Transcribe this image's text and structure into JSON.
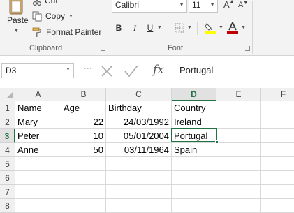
{
  "clipboard": {
    "paste_label": "Paste",
    "cut_label": "Cut",
    "copy_label": "Copy",
    "format_painter_label": "Format Painter",
    "group_label": "Clipboard"
  },
  "font": {
    "name": "Calibri",
    "size": "11",
    "group_label": "Font",
    "grow_label": "A",
    "shrink_label": "A",
    "bold_label": "B",
    "italic_label": "I",
    "underline_label": "U",
    "highlight_color": "#ffff00",
    "font_color": "#c00000"
  },
  "formula_bar": {
    "name_box": "D3",
    "fx_label": "fx",
    "formula": "Portugal"
  },
  "sheet": {
    "columns": [
      "A",
      "B",
      "C",
      "D",
      "E",
      "F"
    ],
    "rows": [
      "1",
      "2",
      "3",
      "4",
      "5",
      "6",
      "7",
      "8"
    ],
    "active_cell": "D3",
    "accent_color": "#217346",
    "data": {
      "header": {
        "a": "Name",
        "b": "Age",
        "c": "Birthday",
        "d": "Country"
      },
      "r2": {
        "a": "Mary",
        "b": "22",
        "c": "24/03/1992",
        "d": "Ireland"
      },
      "r3": {
        "a": "Peter",
        "b": "10",
        "c": "05/01/2004",
        "d": "Portugal"
      },
      "r4": {
        "a": "Anne",
        "b": "50",
        "c": "03/11/1964",
        "d": "Spain"
      }
    }
  }
}
